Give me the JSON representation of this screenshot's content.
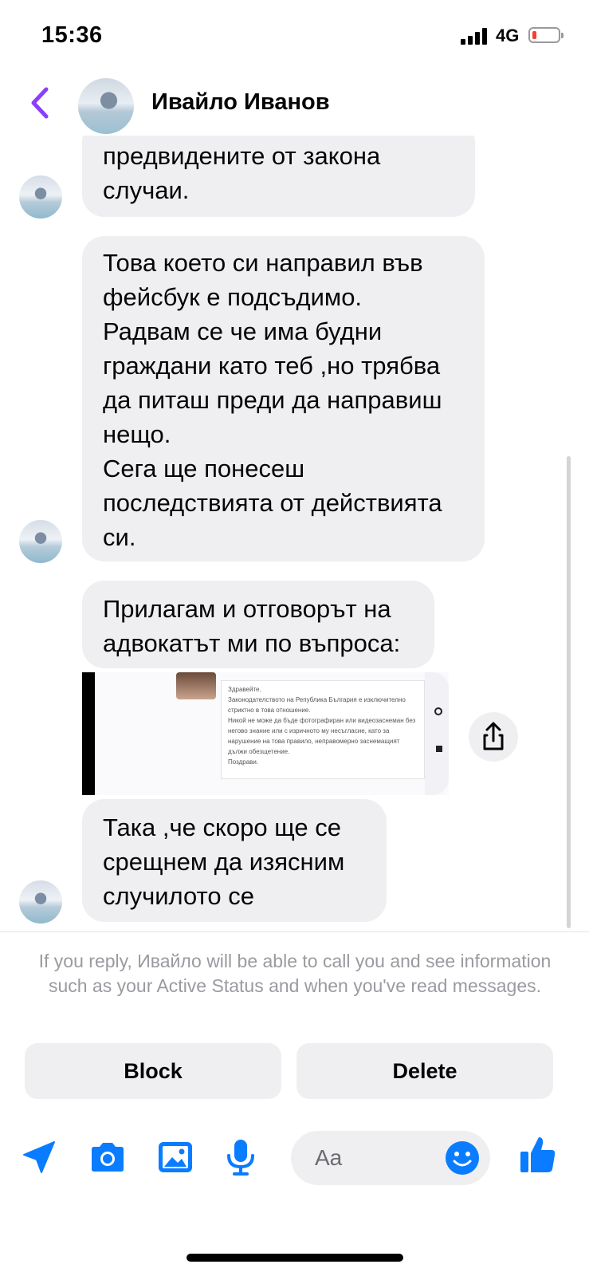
{
  "status": {
    "time": "15:36",
    "network": "4G"
  },
  "header": {
    "contact_name": "Ивайло Иванов"
  },
  "messages": [
    {
      "lines": [
        "предвидените от закона",
        "случаи."
      ]
    },
    {
      "lines": [
        "Това което си направил във",
        "фейсбук е подсъдимо.",
        "Радвам се че има будни",
        "граждани като теб ,но трябва",
        "да питаш преди да направиш",
        "нещо.",
        "Сега ще понесеш",
        "последствията от действията",
        "си."
      ]
    },
    {
      "lines": [
        "Прилагам и отговорът на",
        "адвокатът ми по въпроса:"
      ]
    },
    {
      "lines": [
        "Така ,че скоро ще се",
        "срещнем да изясним",
        "случилото се"
      ]
    }
  ],
  "attachment": {
    "lines": [
      "Здравейте.",
      "Законодателството на Република България е изключително",
      "стриктно в това отношение.",
      "Никой не може да бъде фотографиран или видеозаснеман без",
      "негово знание или с изричното му несъгласие, като за",
      "нарушение на това правило, неправомерно заснемащият",
      "дължи обезщетение.",
      "Поздрави."
    ]
  },
  "footer": {
    "info_text": "If you reply, Ивайло will be able to call you and see information such as your Active Status and when you've read messages.",
    "block_label": "Block",
    "delete_label": "Delete"
  },
  "composer": {
    "placeholder": "Aa"
  },
  "colors": {
    "accent": "#0a7cff",
    "back_arrow": "#8a3ffc",
    "bubble": "#efeff1"
  }
}
